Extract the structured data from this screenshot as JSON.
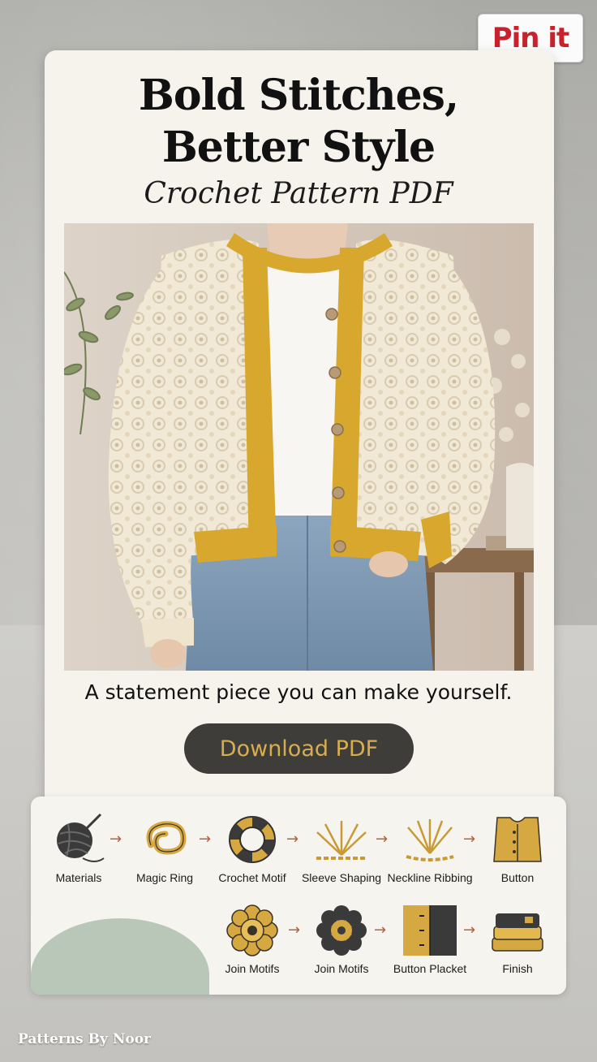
{
  "pin_button": {
    "label": "Pin it"
  },
  "headline": {
    "line1": "Bold Stitches,",
    "line2": "Better Style",
    "subtitle": "Crochet Pattern PDF"
  },
  "tagline": "A statement piece you can make yourself.",
  "cta": {
    "label": "Download PDF"
  },
  "steps_row1": [
    {
      "label": "Materials",
      "icon": "yarn-ball-icon"
    },
    {
      "label": "Magic Ring",
      "icon": "magic-ring-icon"
    },
    {
      "label": "Crochet Motif",
      "icon": "motif-ring-icon"
    },
    {
      "label": "Sleeve Shaping",
      "icon": "sleeve-shaping-icon"
    },
    {
      "label": "Neckline Ribbing",
      "icon": "neckline-ribbing-icon"
    },
    {
      "label": "Button",
      "icon": "cardigan-icon"
    }
  ],
  "steps_row2": [
    {
      "label": "Join Motifs",
      "icon": "gold-flower-motif-icon"
    },
    {
      "label": "Join Motifs",
      "icon": "dark-flower-motif-icon"
    },
    {
      "label": "Button Placket",
      "icon": "button-placket-icon"
    },
    {
      "label": "Finish",
      "icon": "folded-stack-icon"
    }
  ],
  "brand": "Patterns By Noor",
  "colors": {
    "accent_gold": "#d6ae4f",
    "button_dark": "#3e3d3a",
    "pin_red": "#c8232c",
    "card_bg": "#f6f3ed",
    "arrow": "#b5603e"
  }
}
